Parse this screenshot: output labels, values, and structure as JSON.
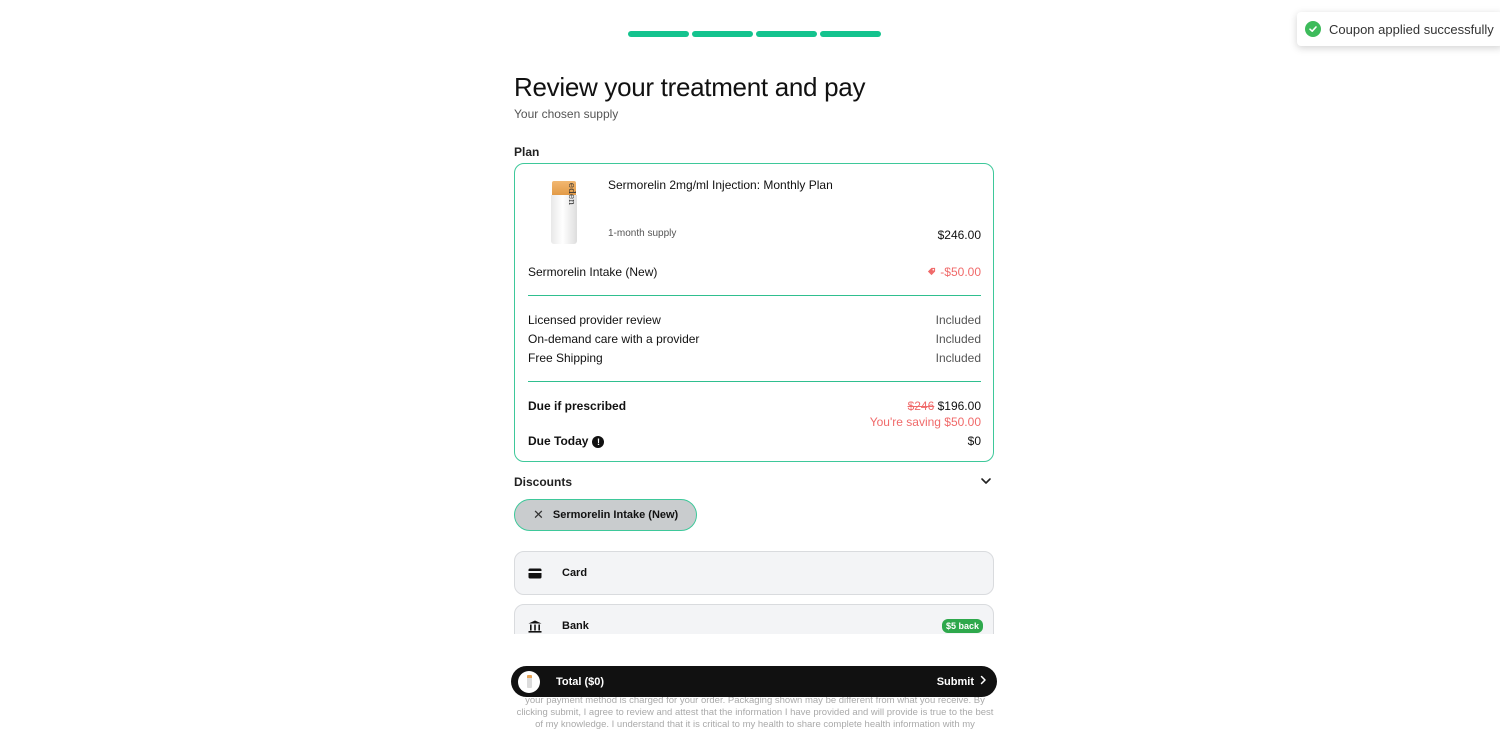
{
  "progress": {
    "steps_total": 4,
    "steps_completed": 4
  },
  "toast": {
    "message": "Coupon applied successfully",
    "icon": "check-circle-icon",
    "color": "#3dbb5b"
  },
  "header": {
    "title": "Review your treatment and pay",
    "subtitle": "Your chosen supply"
  },
  "plan": {
    "label": "Plan",
    "product_name": "Sermorelin 2mg/ml Injection: Monthly Plan",
    "vial_brand": "eden",
    "supply": "1-month supply",
    "price": "$246.00",
    "discount_name": "Sermorelin Intake (New)",
    "discount_amount": "-$50.00",
    "includes": [
      {
        "label": "Licensed provider review",
        "value": "Included"
      },
      {
        "label": "On-demand care with a provider",
        "value": "Included"
      },
      {
        "label": "Free Shipping",
        "value": "Included"
      }
    ],
    "due_if_prescribed_label": "Due if prescribed",
    "original_price": "$246",
    "due_if_prescribed": "$196.00",
    "savings": "You're saving $50.00",
    "due_today_label": "Due Today",
    "due_today": "$0"
  },
  "discounts": {
    "label": "Discounts",
    "applied_code": "Sermorelin Intake (New)"
  },
  "payment_methods": [
    {
      "label": "Card",
      "icon": "credit-card-icon"
    },
    {
      "label": "Bank",
      "icon": "bank-icon",
      "badge": "$5 back"
    }
  ],
  "submit_bar": {
    "total": "Total ($0)",
    "submit_label": "Submit"
  },
  "disclaimer": "your payment method is charged for your order. Packaging shown may be different from what you receive. By clicking submit, I agree to review and attest that the information I have provided and will provide is true to the best of my knowledge. I understand that it is critical to my health to share complete health information with my",
  "colors": {
    "accent": "#14c38e",
    "card_border": "#3ec89a",
    "discount": "#f06a6a",
    "badge": "#2ea84c"
  }
}
